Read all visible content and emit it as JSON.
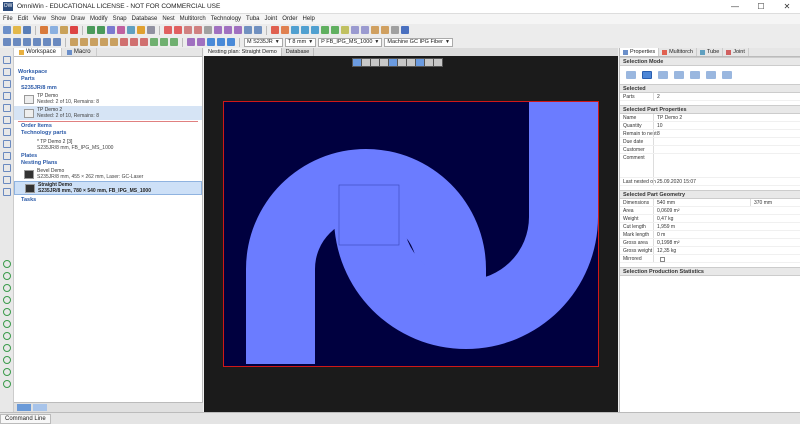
{
  "window": {
    "app_icon": "OW",
    "title": "OmniWin - EDUCATIONAL LICENSE - NOT FOR COMMERCIAL USE",
    "controls": {
      "minimize": "—",
      "maximize": "☐",
      "close": "✕"
    }
  },
  "menu": [
    "File",
    "Edit",
    "View",
    "Show",
    "Draw",
    "Modify",
    "Snap",
    "Database",
    "Nest",
    "Multitorch",
    "Technology",
    "Tuba",
    "Joint",
    "Order",
    "Help"
  ],
  "toolbar": {
    "material_combo": "M S235JR",
    "thickness_combo": "T 8 mm",
    "process_combo": "P FB_IPG_MS_1000",
    "machine_combo": "Machine GC IPG Fiber",
    "arrow": "▼"
  },
  "left_panel": {
    "tabs": [
      "Workspace",
      "Macro"
    ],
    "tree": {
      "workspace": "Workspace",
      "parts": "Parts",
      "material": "S235JR/8 mm",
      "part_items": [
        {
          "name": "TP Demo",
          "status": "Nested: 2 of 10, Remains: 8"
        },
        {
          "name": "TP Demo 2",
          "status": "Nested: 2 of 10, Remains: 8"
        }
      ],
      "order_items": "Order Items",
      "technology_parts": "Technology parts",
      "tech_item": {
        "name": "* TP Demo 2 [3]",
        "status": "S235JR/8 mm, FB_IPG_MS_1000"
      },
      "plates": "Plates",
      "nesting_plans": "Nesting Plans",
      "plans": [
        {
          "name": "Bevel Demo",
          "status": "S235JR/8 mm, 455 × 262 mm, Laser: GC-Laser"
        },
        {
          "name": "Straight Demo",
          "status": "S235JR/8 mm, 780 × 540 mm, FB_IPG_MS_1000"
        }
      ],
      "tasks": "Tasks"
    }
  },
  "canvas": {
    "doc_tabs": [
      "Nesting plan: Straight Demo",
      "Database"
    ]
  },
  "right_panel": {
    "tabs": [
      "Properties",
      "Multitorch",
      "Tube",
      "Joint"
    ],
    "selection_mode": "Selection Mode",
    "selected_header": "Selected",
    "selected_rows": [
      {
        "label": "Parts",
        "value": "2"
      }
    ],
    "part_props_header": "Selected Part Properties",
    "part_props": [
      {
        "label": "Name",
        "value": "TP Demo 2"
      },
      {
        "label": "Quantity",
        "value": "10"
      },
      {
        "label": "Remain to nest",
        "value": "8"
      },
      {
        "label": "Due date",
        "value": ""
      },
      {
        "label": "Customer",
        "value": ""
      },
      {
        "label": "Comment",
        "value": ""
      }
    ],
    "last_nested": {
      "label": "Last nested on",
      "value": "25.09.2020 15:07"
    },
    "geometry_header": "Selected Part Geometry",
    "geometry": [
      {
        "label": "Dimensions",
        "value": "540 mm",
        "value2": "370 mm"
      },
      {
        "label": "Area",
        "value": "0,0609 m²"
      },
      {
        "label": "Weight",
        "value": "0,47 kg"
      },
      {
        "label": "Cut length",
        "value": "1,959 m"
      },
      {
        "label": "Mark length",
        "value": "0 m"
      },
      {
        "label": "Gross area",
        "value": "0,1998 m²"
      },
      {
        "label": "Gross weight",
        "value": "12,35 kg"
      },
      {
        "label": "Mirrored",
        "value": ""
      }
    ],
    "stats_header": "Selection Production Statistics"
  },
  "statusbar": {
    "command_line": "Command Line"
  },
  "colors": {
    "sheet": "#00003f",
    "part": "#6b7cff",
    "sheet_border": "#d01818",
    "accent": "#2b5aa8"
  }
}
